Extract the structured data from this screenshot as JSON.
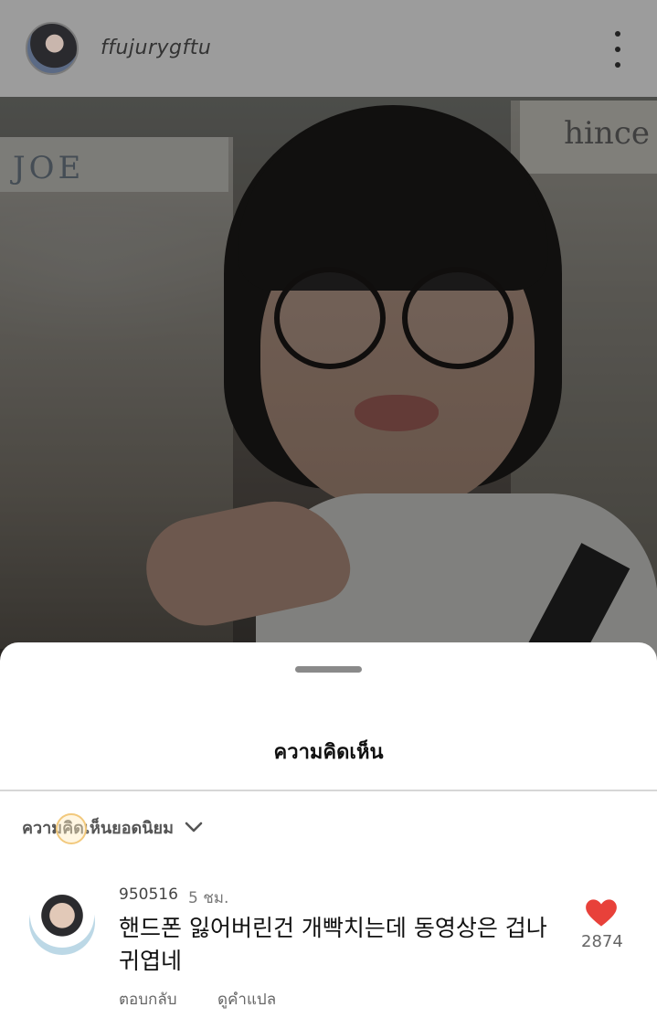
{
  "header": {
    "username": "ffujurygftu",
    "avatar_icon": "profile-avatar",
    "more_icon": "more-vertical-icon"
  },
  "video": {
    "store_sign_left": "JOE",
    "store_sign_right": "hince"
  },
  "sheet": {
    "title": "ความคิดเห็น",
    "sort_label": "ความคิดเห็นยอดนิยม",
    "sort_icon": "chevron-down-icon"
  },
  "comments": [
    {
      "user": "950516",
      "time": "5 ชม.",
      "text": "핸드폰 잃어버린건 개빡치는데 동영상은 겁나 귀엽네",
      "reply_label": "ตอบกลับ",
      "translate_label": "ดูคำแปล",
      "likes": "2874",
      "liked": true,
      "heart_color": "#e8413a"
    }
  ]
}
